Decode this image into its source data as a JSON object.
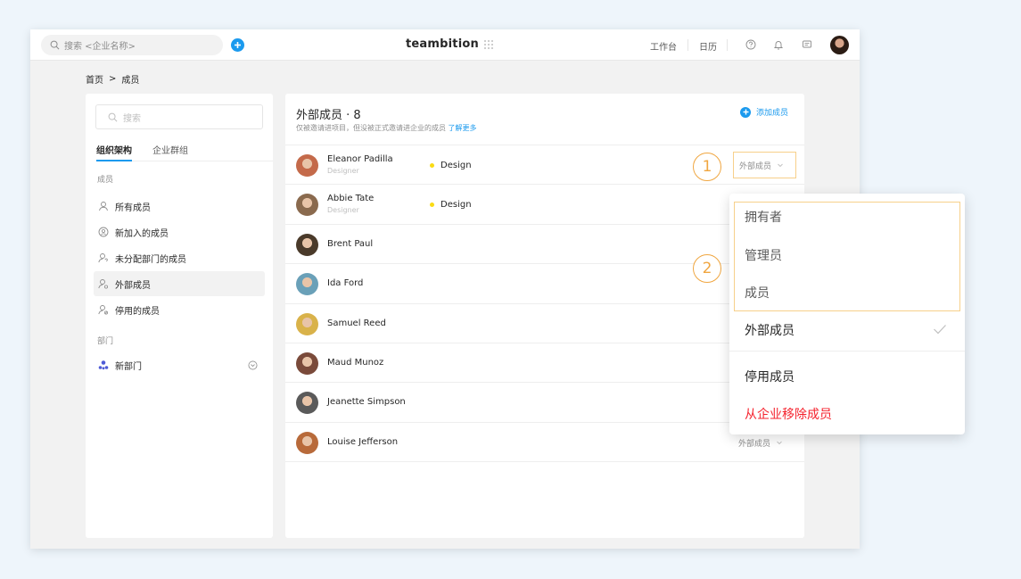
{
  "topbar": {
    "search_placeholder": "搜索 <企业名称>",
    "logo": "teambition",
    "workbench": "工作台",
    "calendar": "日历"
  },
  "breadcrumb": {
    "home": "首页",
    "sep": ">",
    "current": "成员"
  },
  "sidebar": {
    "search_placeholder": "搜索",
    "tabs": [
      "组织架构",
      "企业群组"
    ],
    "members_label": "成员",
    "items": [
      {
        "label": "所有成员",
        "icon": "user-icon"
      },
      {
        "label": "新加入的成员",
        "icon": "smile-icon"
      },
      {
        "label": "未分配部门的成员",
        "icon": "user-question-icon"
      },
      {
        "label": "外部成员",
        "icon": "user-external-icon"
      },
      {
        "label": "停用的成员",
        "icon": "user-disabled-icon"
      }
    ],
    "departments_label": "部门",
    "department": "新部门"
  },
  "panel": {
    "title": "外部成员 · 8",
    "subtitle": "仅被邀请进项目，但没被正式邀请进企业的成员",
    "learn_more": "了解更多",
    "add_member": "添加成员"
  },
  "members": [
    {
      "name": "Eleanor Padilla",
      "title": "Designer",
      "dept": "Design",
      "role": "外部成员",
      "color": "#c46a4a"
    },
    {
      "name": "Abbie Tate",
      "title": "Designer",
      "dept": "Design",
      "role": "",
      "color": "#8a6a4e"
    },
    {
      "name": "Brent Paul",
      "title": "",
      "dept": "",
      "role": "",
      "color": "#4a3a2a"
    },
    {
      "name": "Ida Ford",
      "title": "",
      "dept": "",
      "role": "",
      "color": "#6aa0b8"
    },
    {
      "name": "Samuel Reed",
      "title": "",
      "dept": "",
      "role": "",
      "color": "#d9b24a"
    },
    {
      "name": "Maud Munoz",
      "title": "",
      "dept": "",
      "role": "",
      "color": "#7a4a3a"
    },
    {
      "name": "Jeanette Simpson",
      "title": "",
      "dept": "",
      "role": "",
      "color": "#5a5a5a"
    },
    {
      "name": "Louise Jefferson",
      "title": "",
      "dept": "",
      "role": "外部成员",
      "color": "#b86a3a"
    }
  ],
  "callouts": [
    "1",
    "2"
  ],
  "dropdown": {
    "items": [
      "拥有者",
      "管理员",
      "成员",
      "外部成员",
      "停用成员",
      "从企业移除成员"
    ]
  },
  "colors": {
    "accent": "#1b9aee",
    "highlight": "#f7d08a",
    "callout": "#f0a640",
    "danger": "#f5222d"
  }
}
